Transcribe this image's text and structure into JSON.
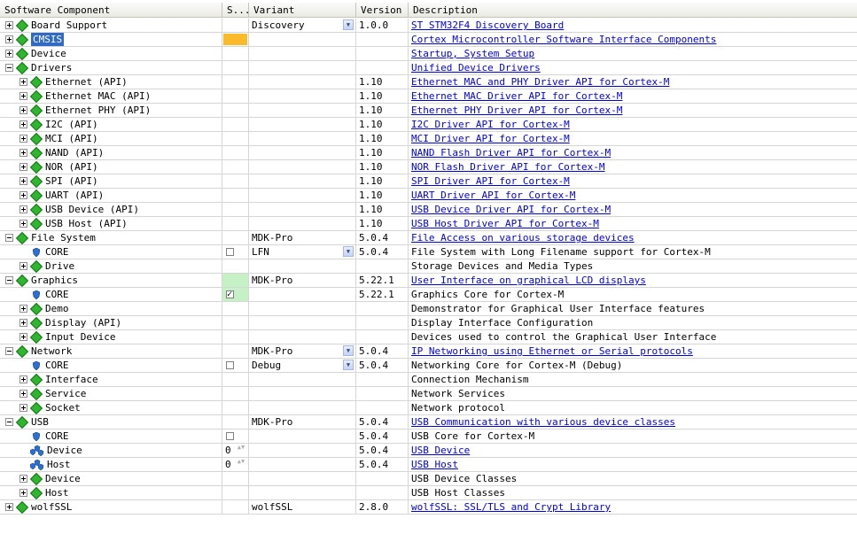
{
  "columns": {
    "component": "Software Component",
    "sel": "S...",
    "variant": "Variant",
    "version": "Version",
    "description": "Description"
  },
  "colors": {
    "selection_highlight": "#316ac5",
    "missing_dependency": "#fbba2a",
    "resolved": "#c6f0c6",
    "link": "#0000ee"
  },
  "rows": [
    {
      "level": 0,
      "expander": "plus",
      "icon": "diamond-icon",
      "name": "Board Support",
      "variant": "Discovery",
      "variant_dropdown": true,
      "version": "1.0.0",
      "description": "ST STM32F4 Discovery Board",
      "link": true
    },
    {
      "level": 0,
      "expander": "plus",
      "icon": "diamond-icon",
      "name": "CMSIS",
      "selected": true,
      "sel_fill": "orange",
      "description": "Cortex Microcontroller Software Interface Components",
      "link": true
    },
    {
      "level": 0,
      "expander": "plus",
      "icon": "diamond-icon",
      "name": "Device",
      "description": "Startup, System Setup",
      "link": true
    },
    {
      "level": 0,
      "expander": "minus",
      "icon": "diamond-icon",
      "name": "Drivers",
      "description": "Unified Device Drivers",
      "link": true
    },
    {
      "level": 1,
      "expander": "plus",
      "icon": "diamond-icon",
      "name": "Ethernet (API)",
      "version": "1.10",
      "description": "Ethernet MAC and PHY Driver API for Cortex-M",
      "link": true
    },
    {
      "level": 1,
      "expander": "plus",
      "icon": "diamond-icon",
      "name": "Ethernet MAC (API)",
      "version": "1.10",
      "description": "Ethernet MAC Driver API for Cortex-M",
      "link": true
    },
    {
      "level": 1,
      "expander": "plus",
      "icon": "diamond-icon",
      "name": "Ethernet PHY (API)",
      "version": "1.10",
      "description": "Ethernet PHY Driver API for Cortex-M",
      "link": true
    },
    {
      "level": 1,
      "expander": "plus",
      "icon": "diamond-icon",
      "name": "I2C (API)",
      "version": "1.10",
      "description": "I2C Driver API for Cortex-M",
      "link": true
    },
    {
      "level": 1,
      "expander": "plus",
      "icon": "diamond-icon",
      "name": "MCI (API)",
      "version": "1.10",
      "description": "MCI Driver API for Cortex-M",
      "link": true
    },
    {
      "level": 1,
      "expander": "plus",
      "icon": "diamond-icon",
      "name": "NAND (API)",
      "version": "1.10",
      "description": "NAND Flash Driver API for Cortex-M",
      "link": true
    },
    {
      "level": 1,
      "expander": "plus",
      "icon": "diamond-icon",
      "name": "NOR (API)",
      "version": "1.10",
      "description": "NOR Flash Driver API for Cortex-M",
      "link": true
    },
    {
      "level": 1,
      "expander": "plus",
      "icon": "diamond-icon",
      "name": "SPI (API)",
      "version": "1.10",
      "description": "SPI Driver API for Cortex-M",
      "link": true
    },
    {
      "level": 1,
      "expander": "plus",
      "icon": "diamond-icon",
      "name": "UART (API)",
      "version": "1.10",
      "description": "UART Driver API for Cortex-M",
      "link": true
    },
    {
      "level": 1,
      "expander": "plus",
      "icon": "diamond-icon",
      "name": "USB Device (API)",
      "version": "1.10",
      "description": "USB Device Driver API for Cortex-M",
      "link": true
    },
    {
      "level": 1,
      "expander": "plus",
      "icon": "diamond-icon",
      "name": "USB Host (API)",
      "version": "1.10",
      "description": "USB Host Driver API for Cortex-M",
      "link": true
    },
    {
      "level": 0,
      "expander": "minus",
      "icon": "diamond-icon",
      "name": "File System",
      "variant": "MDK-Pro",
      "version": "5.0.4",
      "description": "File Access on various storage devices",
      "link": true
    },
    {
      "level": 1,
      "expander": "none",
      "icon": "shield-icon",
      "name": "CORE",
      "sel_check": "unchecked",
      "variant": "LFN",
      "variant_dropdown": true,
      "version": "5.0.4",
      "description": "File System with Long Filename support for Cortex-M"
    },
    {
      "level": 1,
      "expander": "plus",
      "icon": "diamond-icon",
      "name": "Drive",
      "description": "Storage Devices and Media Types"
    },
    {
      "level": 0,
      "expander": "minus",
      "icon": "diamond-icon",
      "name": "Graphics",
      "sel_fill": "green",
      "variant": "MDK-Pro",
      "version": "5.22.1",
      "description": "User Interface on graphical LCD displays",
      "link": true
    },
    {
      "level": 1,
      "expander": "none",
      "icon": "shield-icon",
      "name": "CORE",
      "sel_check": "checked",
      "sel_fill": "green",
      "version": "5.22.1",
      "description": "Graphics Core for Cortex-M"
    },
    {
      "level": 1,
      "expander": "plus",
      "icon": "diamond-icon",
      "name": "Demo",
      "description": "Demonstrator for Graphical User Interface features"
    },
    {
      "level": 1,
      "expander": "plus",
      "icon": "diamond-icon",
      "name": "Display (API)",
      "description": "Display Interface Configuration"
    },
    {
      "level": 1,
      "expander": "plus",
      "icon": "diamond-icon",
      "name": "Input Device",
      "description": "Devices used to control the Graphical User Interface"
    },
    {
      "level": 0,
      "expander": "minus",
      "icon": "diamond-icon",
      "name": "Network",
      "variant": "MDK-Pro",
      "variant_dropdown": true,
      "version": "5.0.4",
      "description": "IP Networking using Ethernet or Serial protocols",
      "link": true
    },
    {
      "level": 1,
      "expander": "none",
      "icon": "shield-icon",
      "name": "CORE",
      "sel_check": "unchecked",
      "variant": "Debug",
      "variant_dropdown": true,
      "version": "5.0.4",
      "description": "Networking Core for Cortex-M (Debug)"
    },
    {
      "level": 1,
      "expander": "plus",
      "icon": "diamond-icon",
      "name": "Interface",
      "description": "Connection Mechanism"
    },
    {
      "level": 1,
      "expander": "plus",
      "icon": "diamond-icon",
      "name": "Service",
      "description": "Network Services"
    },
    {
      "level": 1,
      "expander": "plus",
      "icon": "diamond-icon",
      "name": "Socket",
      "description": "Network protocol"
    },
    {
      "level": 0,
      "expander": "minus",
      "icon": "diamond-icon",
      "name": "USB",
      "variant": "MDK-Pro",
      "version": "5.0.4",
      "description": "USB Communication with various device classes",
      "link": true
    },
    {
      "level": 1,
      "expander": "none",
      "icon": "shield-icon",
      "name": "CORE",
      "sel_check": "unchecked",
      "version": "5.0.4",
      "description": "USB Core for Cortex-M"
    },
    {
      "level": 1,
      "expander": "none",
      "icon": "multi-instance-icon",
      "name": "Device",
      "sel_spin": "0",
      "version": "5.0.4",
      "description": "USB Device",
      "link": true
    },
    {
      "level": 1,
      "expander": "none",
      "icon": "multi-instance-icon",
      "name": "Host",
      "sel_spin": "0",
      "version": "5.0.4",
      "description": "USB Host",
      "link": true
    },
    {
      "level": 1,
      "expander": "plus",
      "icon": "diamond-icon",
      "name": "Device",
      "description": "USB Device Classes"
    },
    {
      "level": 1,
      "expander": "plus",
      "icon": "diamond-icon",
      "name": "Host",
      "description": "USB Host Classes"
    },
    {
      "level": 0,
      "expander": "plus",
      "icon": "diamond-icon",
      "name": "wolfSSL",
      "variant": "wolfSSL",
      "version": "2.8.0",
      "description": "wolfSSL: SSL/TLS and Crypt Library",
      "link": true
    }
  ]
}
